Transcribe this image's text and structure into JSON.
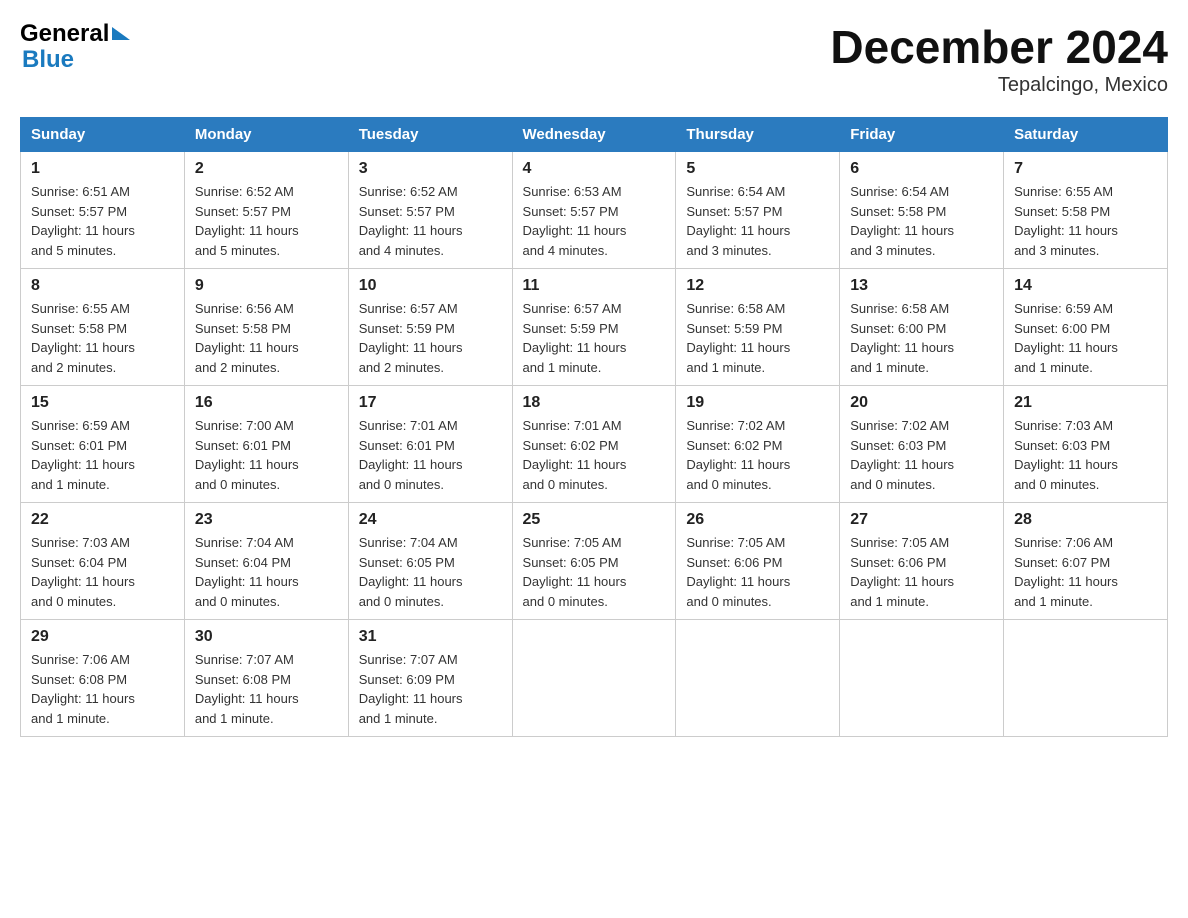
{
  "header": {
    "title": "December 2024",
    "subtitle": "Tepalcingo, Mexico"
  },
  "logo": {
    "part1": "General",
    "part2": "Blue"
  },
  "days": [
    "Sunday",
    "Monday",
    "Tuesday",
    "Wednesday",
    "Thursday",
    "Friday",
    "Saturday"
  ],
  "weeks": [
    [
      {
        "num": "1",
        "sunrise": "6:51 AM",
        "sunset": "5:57 PM",
        "daylight": "11 hours and 5 minutes."
      },
      {
        "num": "2",
        "sunrise": "6:52 AM",
        "sunset": "5:57 PM",
        "daylight": "11 hours and 5 minutes."
      },
      {
        "num": "3",
        "sunrise": "6:52 AM",
        "sunset": "5:57 PM",
        "daylight": "11 hours and 4 minutes."
      },
      {
        "num": "4",
        "sunrise": "6:53 AM",
        "sunset": "5:57 PM",
        "daylight": "11 hours and 4 minutes."
      },
      {
        "num": "5",
        "sunrise": "6:54 AM",
        "sunset": "5:57 PM",
        "daylight": "11 hours and 3 minutes."
      },
      {
        "num": "6",
        "sunrise": "6:54 AM",
        "sunset": "5:58 PM",
        "daylight": "11 hours and 3 minutes."
      },
      {
        "num": "7",
        "sunrise": "6:55 AM",
        "sunset": "5:58 PM",
        "daylight": "11 hours and 3 minutes."
      }
    ],
    [
      {
        "num": "8",
        "sunrise": "6:55 AM",
        "sunset": "5:58 PM",
        "daylight": "11 hours and 2 minutes."
      },
      {
        "num": "9",
        "sunrise": "6:56 AM",
        "sunset": "5:58 PM",
        "daylight": "11 hours and 2 minutes."
      },
      {
        "num": "10",
        "sunrise": "6:57 AM",
        "sunset": "5:59 PM",
        "daylight": "11 hours and 2 minutes."
      },
      {
        "num": "11",
        "sunrise": "6:57 AM",
        "sunset": "5:59 PM",
        "daylight": "11 hours and 1 minute."
      },
      {
        "num": "12",
        "sunrise": "6:58 AM",
        "sunset": "5:59 PM",
        "daylight": "11 hours and 1 minute."
      },
      {
        "num": "13",
        "sunrise": "6:58 AM",
        "sunset": "6:00 PM",
        "daylight": "11 hours and 1 minute."
      },
      {
        "num": "14",
        "sunrise": "6:59 AM",
        "sunset": "6:00 PM",
        "daylight": "11 hours and 1 minute."
      }
    ],
    [
      {
        "num": "15",
        "sunrise": "6:59 AM",
        "sunset": "6:01 PM",
        "daylight": "11 hours and 1 minute."
      },
      {
        "num": "16",
        "sunrise": "7:00 AM",
        "sunset": "6:01 PM",
        "daylight": "11 hours and 0 minutes."
      },
      {
        "num": "17",
        "sunrise": "7:01 AM",
        "sunset": "6:01 PM",
        "daylight": "11 hours and 0 minutes."
      },
      {
        "num": "18",
        "sunrise": "7:01 AM",
        "sunset": "6:02 PM",
        "daylight": "11 hours and 0 minutes."
      },
      {
        "num": "19",
        "sunrise": "7:02 AM",
        "sunset": "6:02 PM",
        "daylight": "11 hours and 0 minutes."
      },
      {
        "num": "20",
        "sunrise": "7:02 AM",
        "sunset": "6:03 PM",
        "daylight": "11 hours and 0 minutes."
      },
      {
        "num": "21",
        "sunrise": "7:03 AM",
        "sunset": "6:03 PM",
        "daylight": "11 hours and 0 minutes."
      }
    ],
    [
      {
        "num": "22",
        "sunrise": "7:03 AM",
        "sunset": "6:04 PM",
        "daylight": "11 hours and 0 minutes."
      },
      {
        "num": "23",
        "sunrise": "7:04 AM",
        "sunset": "6:04 PM",
        "daylight": "11 hours and 0 minutes."
      },
      {
        "num": "24",
        "sunrise": "7:04 AM",
        "sunset": "6:05 PM",
        "daylight": "11 hours and 0 minutes."
      },
      {
        "num": "25",
        "sunrise": "7:05 AM",
        "sunset": "6:05 PM",
        "daylight": "11 hours and 0 minutes."
      },
      {
        "num": "26",
        "sunrise": "7:05 AM",
        "sunset": "6:06 PM",
        "daylight": "11 hours and 0 minutes."
      },
      {
        "num": "27",
        "sunrise": "7:05 AM",
        "sunset": "6:06 PM",
        "daylight": "11 hours and 1 minute."
      },
      {
        "num": "28",
        "sunrise": "7:06 AM",
        "sunset": "6:07 PM",
        "daylight": "11 hours and 1 minute."
      }
    ],
    [
      {
        "num": "29",
        "sunrise": "7:06 AM",
        "sunset": "6:08 PM",
        "daylight": "11 hours and 1 minute."
      },
      {
        "num": "30",
        "sunrise": "7:07 AM",
        "sunset": "6:08 PM",
        "daylight": "11 hours and 1 minute."
      },
      {
        "num": "31",
        "sunrise": "7:07 AM",
        "sunset": "6:09 PM",
        "daylight": "11 hours and 1 minute."
      },
      null,
      null,
      null,
      null
    ]
  ],
  "labels": {
    "sunrise": "Sunrise:",
    "sunset": "Sunset:",
    "daylight": "Daylight:"
  }
}
